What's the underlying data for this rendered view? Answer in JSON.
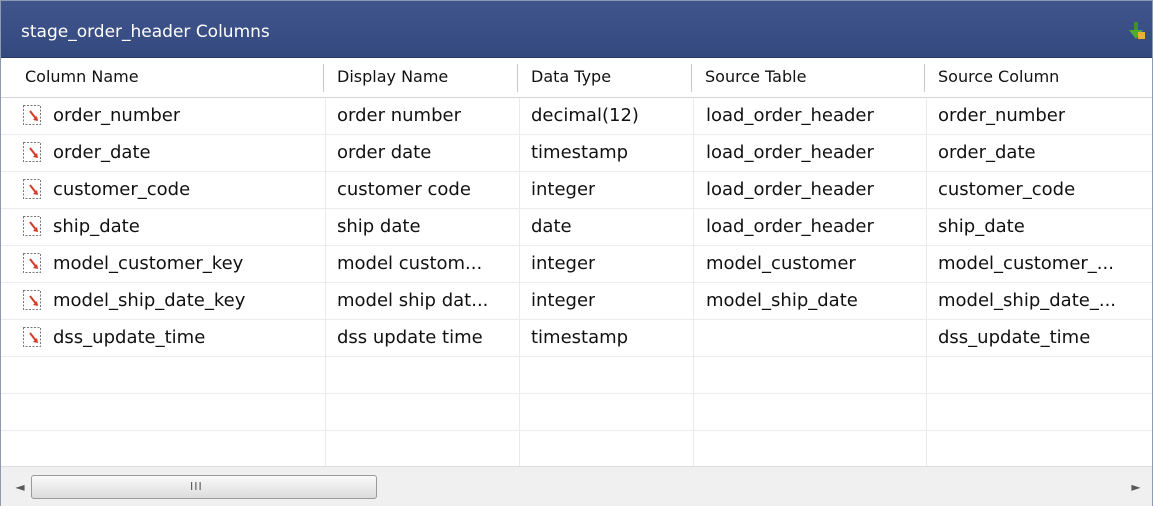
{
  "panel": {
    "title": "stage_order_header Columns",
    "pin_icon": "pin-icon"
  },
  "grid": {
    "headers": [
      "Column Name",
      "Display Name",
      "Data Type",
      "Source Table",
      "Source Column"
    ],
    "rows": [
      {
        "name": "order_number",
        "display": "order number",
        "type": "decimal(12)",
        "source_table": "load_order_header",
        "source_column": "order_number"
      },
      {
        "name": "order_date",
        "display": "order date",
        "type": "timestamp",
        "source_table": "load_order_header",
        "source_column": "order_date"
      },
      {
        "name": "customer_code",
        "display": "customer code",
        "type": "integer",
        "source_table": "load_order_header",
        "source_column": "customer_code"
      },
      {
        "name": "ship_date",
        "display": "ship date",
        "type": "date",
        "source_table": "load_order_header",
        "source_column": "ship_date"
      },
      {
        "name": "model_customer_key",
        "display": "model custom...",
        "type": "integer",
        "source_table": "model_customer",
        "source_column": "model_customer_..."
      },
      {
        "name": "model_ship_date_key",
        "display": "model ship dat...",
        "type": "integer",
        "source_table": "model_ship_date",
        "source_column": "model_ship_date_..."
      },
      {
        "name": "dss_update_time",
        "display": "dss update time",
        "type": "timestamp",
        "source_table": "",
        "source_column": "dss_update_time"
      }
    ],
    "row_icon": "column-mapping-icon"
  },
  "scrollbar": {
    "left_arrow": "◄",
    "right_arrow": "►",
    "grip": "III"
  },
  "colors": {
    "titlebar": "#3b4f86",
    "icon_red": "#d63b2a"
  }
}
